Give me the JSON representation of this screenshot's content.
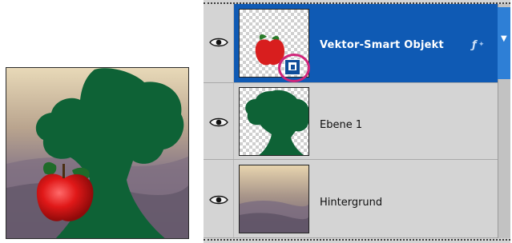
{
  "layers_panel": {
    "layers": [
      {
        "name": "Vektor-Smart Objekt",
        "visible": true,
        "selected": true,
        "thumbnail": "apple-on-transparent",
        "badge_icon": "smart-object-icon",
        "extra_icon": "fx-icon"
      },
      {
        "name": "Ebene 1",
        "visible": true,
        "selected": false,
        "thumbnail": "tree-on-transparent"
      },
      {
        "name": "Hintergrund",
        "visible": true,
        "selected": false,
        "thumbnail": "landscape-photo"
      }
    ]
  },
  "colors": {
    "selection": "#0f5ab4",
    "panel_bg": "#d4d4d4",
    "highlight_ring": "#d0257a",
    "tree_green": "#0e6236",
    "apple_red": "#d81e1e"
  },
  "composite": {
    "description_icon": "composite-image"
  }
}
